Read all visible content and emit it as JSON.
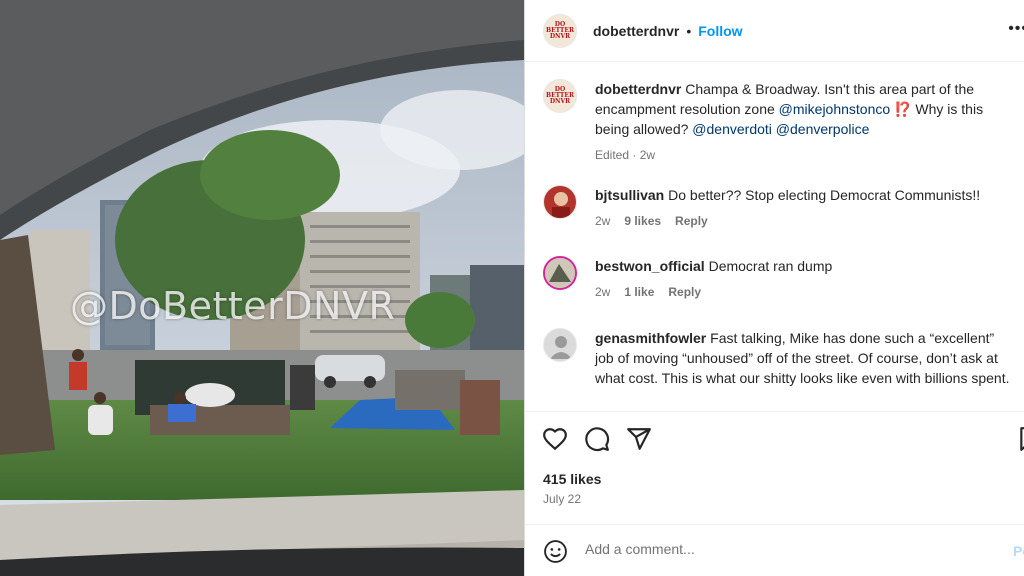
{
  "photo": {
    "watermark": "@DoBetterDNVR",
    "description_icon": "street-photo"
  },
  "header": {
    "username": "dobetterdnvr",
    "separator": "•",
    "follow_label": "Follow",
    "avatar_text": [
      "DO",
      "BETTER",
      "DNVR"
    ],
    "more_icon": "more-horizontal-icon",
    "more_label": "•••"
  },
  "caption": {
    "username": "dobetterdnvr",
    "text_part1": "Champa & Broadway. Isn't this area part of the encampment resolution zone ",
    "mention1": "@mikejohnstonco",
    "emoji": "⁉️",
    "text_part2": " Why is this being allowed? ",
    "mention2": "@denverdoti",
    "mention3": "@denverpolice",
    "meta": "Edited · 2w"
  },
  "comments": [
    {
      "username": "bjtsullivan",
      "text": "Do better?? Stop electing Democrat Communists!!",
      "time": "2w",
      "likes": "9 likes",
      "reply": "Reply"
    },
    {
      "username": "bestwon_official",
      "text": "Democrat ran dump",
      "time": "2w",
      "likes": "1 like",
      "reply": "Reply"
    },
    {
      "username": "genasmithfowler",
      "text": "Fast talking, Mike has done such a “excellent” job of moving “unhoused” off of the street. Of course, don’t ask at what cost. This is what our shitty looks like even with billions spent."
    }
  ],
  "actions": {
    "like_icon": "heart-icon",
    "comment_icon": "comment-bubble-icon",
    "share_icon": "paper-plane-icon",
    "save_icon": "bookmark-icon"
  },
  "stats": {
    "likes": "415 likes",
    "date": "July 22"
  },
  "add_comment": {
    "emoji_icon": "smiley-icon",
    "placeholder": "Add a comment...",
    "post_label": "Post"
  },
  "colors": {
    "accent": "#0095f6",
    "mention": "#00376b",
    "muted": "#737373",
    "post_disabled": "#b3dbff",
    "reaction_emoji": "#e0245e"
  }
}
